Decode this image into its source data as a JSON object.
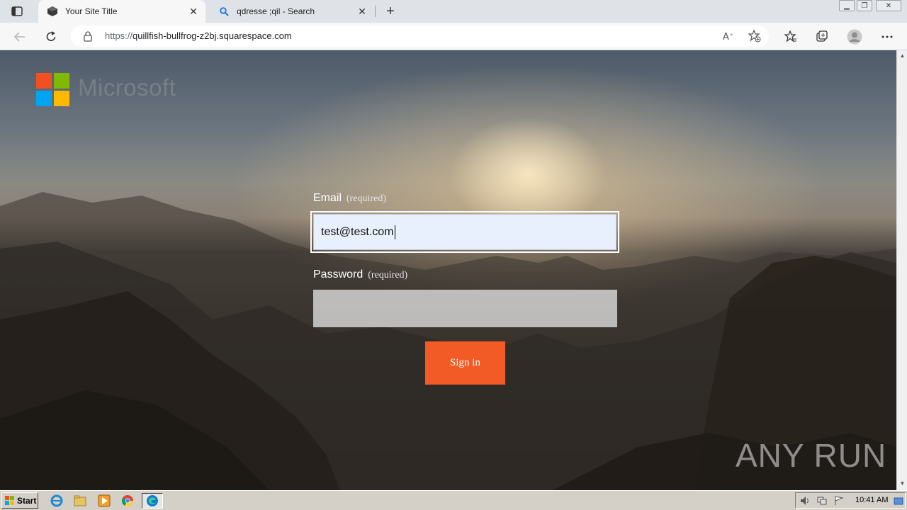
{
  "browser": {
    "tabs": [
      {
        "title": "Your Site Title",
        "active": true
      },
      {
        "title": "qdresse ;qil - Search",
        "active": false
      }
    ],
    "address": {
      "protocol": "https://",
      "host": "quillfish-bullfrog-z2bj.squarespace.com"
    }
  },
  "page": {
    "brand": "Microsoft",
    "email": {
      "label": "Email",
      "required_note": "(required)",
      "value": "test@test.com"
    },
    "password": {
      "label": "Password",
      "required_note": "(required)",
      "value": ""
    },
    "signin_label": "Sign in",
    "watermark": "ANY RUN"
  },
  "taskbar": {
    "start_label": "Start",
    "clock": "10:41 AM"
  },
  "colors": {
    "accent_button": "#f35b26",
    "ms_red": "#f25022",
    "ms_green": "#7fba00",
    "ms_blue": "#00a4ef",
    "ms_yellow": "#ffb900"
  }
}
